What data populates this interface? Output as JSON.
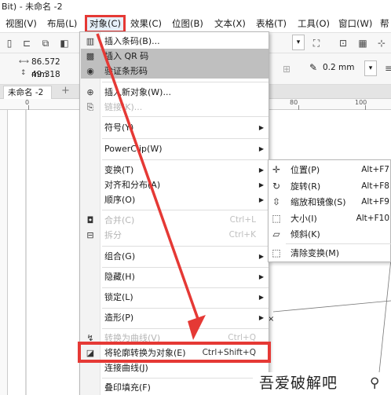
{
  "window": {
    "title": "Bit) - 未命名 -2"
  },
  "menubar": {
    "items": [
      {
        "label": "视图(V)"
      },
      {
        "label": "布局(L)"
      },
      {
        "label": "对象(C)"
      },
      {
        "label": "效果(C)"
      },
      {
        "label": "位图(B)"
      },
      {
        "label": "文本(X)"
      },
      {
        "label": "表格(T)"
      },
      {
        "label": "工具(O)"
      },
      {
        "label": "窗口(W)"
      },
      {
        "label": "帮"
      }
    ],
    "active": "对象(C)"
  },
  "property_bar": {
    "width_value": "86.572 mm",
    "height_value": "49.318 mm",
    "outline_width": "0.2 mm"
  },
  "document_tab": {
    "label": "未命名 -2",
    "add": "+"
  },
  "ruler": {
    "labels": [
      "0",
      "80",
      "100"
    ]
  },
  "object_menu": {
    "items": [
      {
        "label": "插入条码(B)...",
        "icon": "barcode-icon"
      },
      {
        "label": "插入 QR 码",
        "icon": "qr-code-icon"
      },
      {
        "label": "验证条形码",
        "icon": "verify-barcode-icon"
      },
      {
        "label": "插入新对象(W)...",
        "icon": "insert-object-icon"
      },
      {
        "label": "链接(K)...",
        "icon": "link-icon"
      },
      {
        "label": "符号(Y)"
      },
      {
        "label": "PowerClip(W)"
      },
      {
        "label": "变换(T)"
      },
      {
        "label": "对齐和分布(A)"
      },
      {
        "label": "顺序(O)"
      },
      {
        "label": "合并(C)",
        "shortcut": "Ctrl+L",
        "icon": "combine-icon"
      },
      {
        "label": "拆分",
        "shortcut": "Ctrl+K",
        "icon": "break-apart-icon"
      },
      {
        "label": "组合(G)"
      },
      {
        "label": "隐藏(H)"
      },
      {
        "label": "锁定(L)"
      },
      {
        "label": "造形(P)"
      },
      {
        "label": "转换为曲线(V)",
        "shortcut": "Ctrl+Q",
        "icon": "convert-curve-icon"
      },
      {
        "label": "将轮廓转换为对象(E)",
        "shortcut": "Ctrl+Shift+Q",
        "icon": "outline-to-object-icon"
      },
      {
        "label": "连接曲线(J)"
      },
      {
        "label": "叠印填充(F)"
      }
    ]
  },
  "transform_submenu": {
    "items": [
      {
        "label": "位置(P)",
        "shortcut": "Alt+F7",
        "icon": "position-icon"
      },
      {
        "label": "旋转(R)",
        "shortcut": "Alt+F8",
        "icon": "rotate-icon"
      },
      {
        "label": "缩放和镜像(S)",
        "shortcut": "Alt+F9",
        "icon": "scale-mirror-icon"
      },
      {
        "label": "大小(I)",
        "shortcut": "Alt+F10",
        "icon": "size-icon"
      },
      {
        "label": "倾斜(K)",
        "icon": "skew-icon"
      },
      {
        "label": "清除变换(M)",
        "icon": "clear-transform-icon"
      }
    ]
  },
  "annotation": {
    "color": "#e53935"
  },
  "watermark": {
    "text": "吾爱破解吧"
  }
}
